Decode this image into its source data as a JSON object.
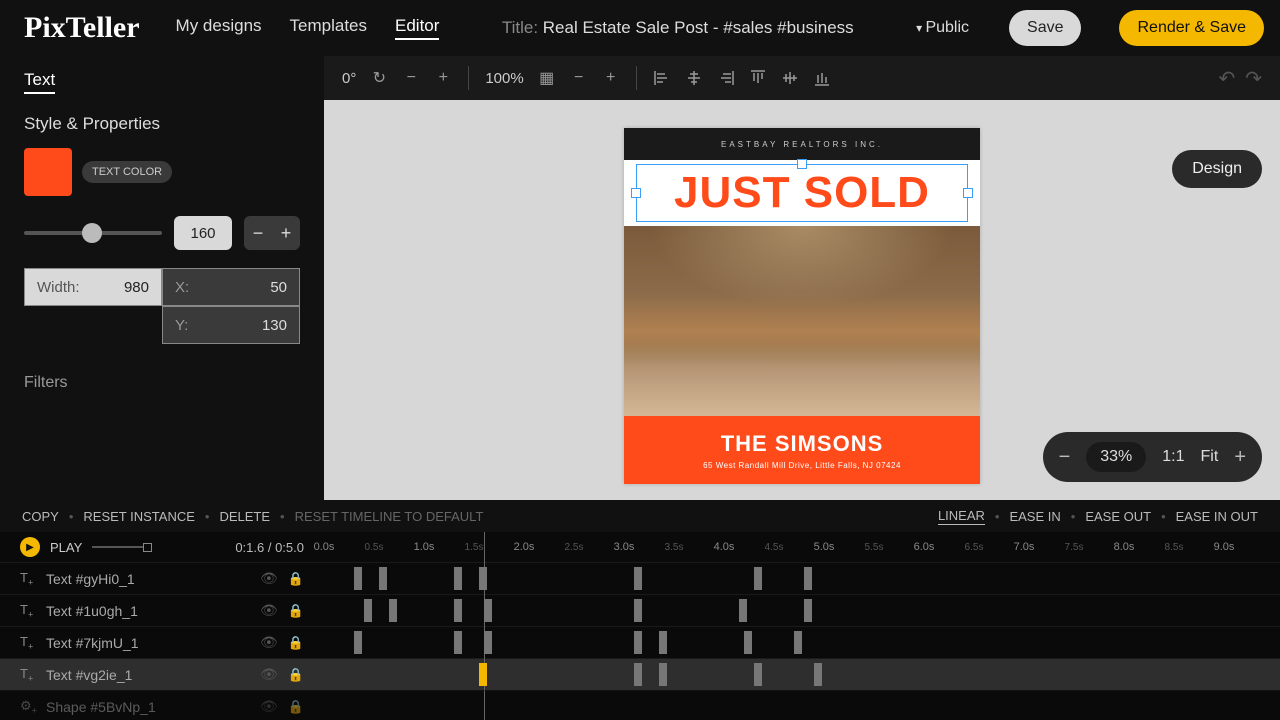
{
  "logo": "PixTeller",
  "nav": {
    "mydesigns": "My designs",
    "templates": "Templates",
    "editor": "Editor"
  },
  "title": {
    "label": "Title:",
    "value": "Real Estate Sale Post - #sales #business"
  },
  "visibility": "Public",
  "buttons": {
    "save": "Save",
    "render": "Render & Save"
  },
  "sidebar": {
    "tab": "Text",
    "section": "Style & Properties",
    "textcolor_label": "TEXT COLOR",
    "size": "160",
    "width_label": "Width:",
    "width": "980",
    "x_label": "X:",
    "x": "50",
    "y_label": "Y:",
    "y": "130",
    "filters": "Filters"
  },
  "toolbar": {
    "rotate": "0°",
    "opacity": "100%"
  },
  "design_btn": "Design",
  "zoom": {
    "pct": "33%",
    "one": "1:1",
    "fit": "Fit"
  },
  "poster": {
    "company": "EASTBAY REALTORS INC.",
    "headline": "JUST SOLD",
    "family": "THE SIMSONS",
    "address": "65 West Randall Mill Drive, Little Falls, NJ 07424"
  },
  "tlactions": {
    "copy": "COPY",
    "reset": "RESET INSTANCE",
    "del": "DELETE",
    "resettl": "RESET TIMELINE TO DEFAULT",
    "linear": "LINEAR",
    "easein": "EASE IN",
    "easeout": "EASE OUT",
    "easeinout": "EASE IN OUT"
  },
  "play": {
    "label": "PLAY",
    "time": "0:1.6 / 0:5.0"
  },
  "ticks": [
    "0.0s",
    "0.5s",
    "1.0s",
    "1.5s",
    "2.0s",
    "2.5s",
    "3.0s",
    "3.5s",
    "4.0s",
    "4.5s",
    "5.0s",
    "5.5s",
    "6.0s",
    "6.5s",
    "7.0s",
    "7.5s",
    "8.0s",
    "8.5s",
    "9.0s"
  ],
  "layers": [
    {
      "name": "Text #gyHi0_1",
      "icon": "T"
    },
    {
      "name": "Text #1u0gh_1",
      "icon": "T"
    },
    {
      "name": "Text #7kjmU_1",
      "icon": "T"
    },
    {
      "name": "Text #vg2ie_1",
      "icon": "T",
      "sel": true
    },
    {
      "name": "Shape #5BvNp_1",
      "icon": "⚙",
      "dim": true
    }
  ]
}
